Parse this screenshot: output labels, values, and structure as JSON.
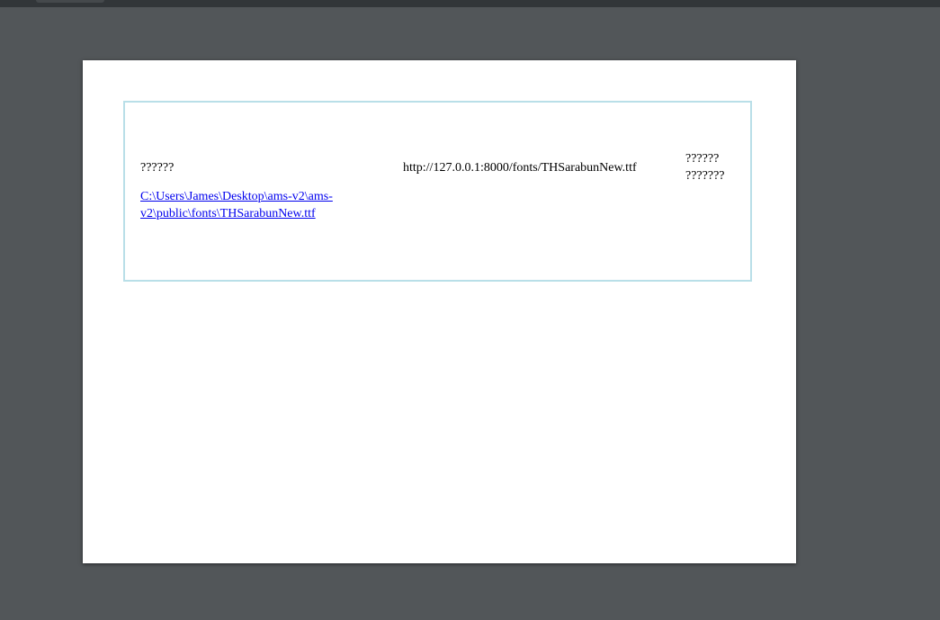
{
  "document": {
    "left_label": "??????",
    "font_path_link": "C:\\Users\\James\\Desktop\\ams-v2\\ams-v2\\public\\fonts\\THSarabunNew.ttf",
    "font_url": "http://127.0.0.1:8000/fonts/THSarabunNew.ttf",
    "right_label_line1": "??????",
    "right_label_line2": "???????"
  },
  "colors": {
    "viewer_background": "#525659",
    "toolbar_background": "#323639",
    "page_background": "#ffffff",
    "frame_border": "#b9dfe8",
    "link_color": "#0000ee"
  }
}
